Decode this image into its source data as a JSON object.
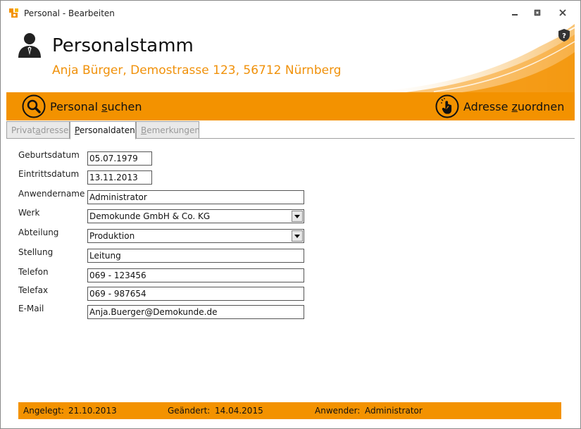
{
  "window": {
    "title": "Personal - Bearbeiten"
  },
  "header": {
    "title": "Personalstamm",
    "subtitle": "Anja Bürger, Demostrasse 123, 56712 Nürnberg"
  },
  "toolbar": {
    "search_label_pre": "Personal ",
    "search_label_ul": "s",
    "search_label_post": "uchen",
    "assign_label_pre": "Adresse ",
    "assign_label_ul": "z",
    "assign_label_post": "uordnen"
  },
  "tabs": [
    {
      "pre": "Privat",
      "ul": "a",
      "post": "dresse",
      "active": false
    },
    {
      "pre": "",
      "ul": "P",
      "post": "ersonaldaten",
      "active": true
    },
    {
      "pre": "",
      "ul": "B",
      "post": "emerkungen",
      "active": false
    }
  ],
  "form": {
    "geburtsdatum": {
      "label": "Geburtsdatum",
      "value": "05.07.1979"
    },
    "eintrittsdatum": {
      "label": "Eintrittsdatum",
      "value": "13.11.2013"
    },
    "anwendername": {
      "label": "Anwendername",
      "value": "Administrator"
    },
    "werk": {
      "label": "Werk",
      "value": "Demokunde GmbH & Co. KG"
    },
    "abteilung": {
      "label": "Abteilung",
      "value": "Produktion"
    },
    "stellung": {
      "label": "Stellung",
      "value": "Leitung"
    },
    "telefon": {
      "label": "Telefon",
      "value": "069 - 123456"
    },
    "telefax": {
      "label": "Telefax",
      "value": "069 - 987654"
    },
    "email": {
      "label": "E-Mail",
      "value": "Anja.Buerger@Demokunde.de"
    }
  },
  "status": {
    "angelegt_label": "Angelegt:",
    "angelegt_value": "21.10.2013",
    "geaendert_label": "Geändert:",
    "geaendert_value": "14.04.2015",
    "anwender_label": "Anwender:",
    "anwender_value": "Administrator"
  },
  "colors": {
    "accent": "#f39200",
    "subtitle": "#f0910a"
  }
}
